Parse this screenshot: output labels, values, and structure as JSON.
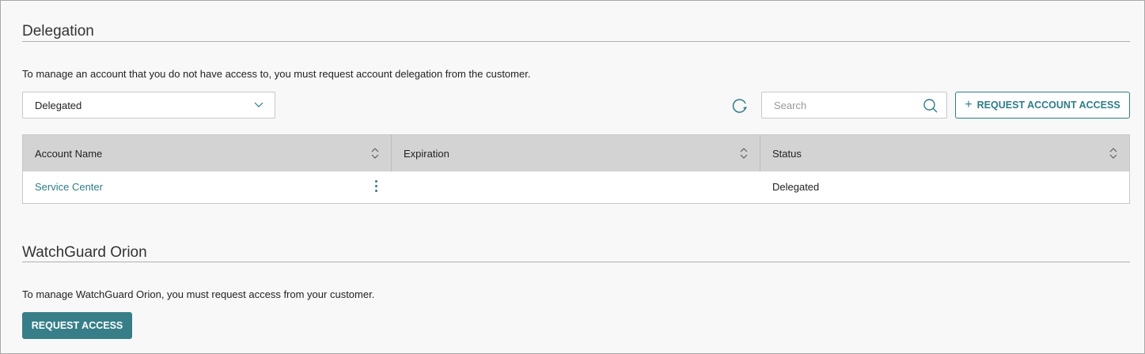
{
  "delegation": {
    "title": "Delegation",
    "description": "To manage an account that you do not have access to, you must request account delegation from the customer.",
    "filter_value": "Delegated",
    "search_placeholder": "Search",
    "request_account_access_label": "REQUEST ACCOUNT ACCESS",
    "table": {
      "columns": [
        "Account Name",
        "Expiration",
        "Status"
      ],
      "rows": [
        {
          "account_name": "Service Center",
          "expiration": "",
          "status": "Delegated"
        }
      ]
    }
  },
  "orion": {
    "title": "WatchGuard Orion",
    "description": "To manage WatchGuard Orion, you must request access from your customer.",
    "request_access_label": "REQUEST ACCESS"
  },
  "colors": {
    "accent": "#2e7d87",
    "button": "#377e88",
    "header_bg": "#d3d3d3"
  }
}
